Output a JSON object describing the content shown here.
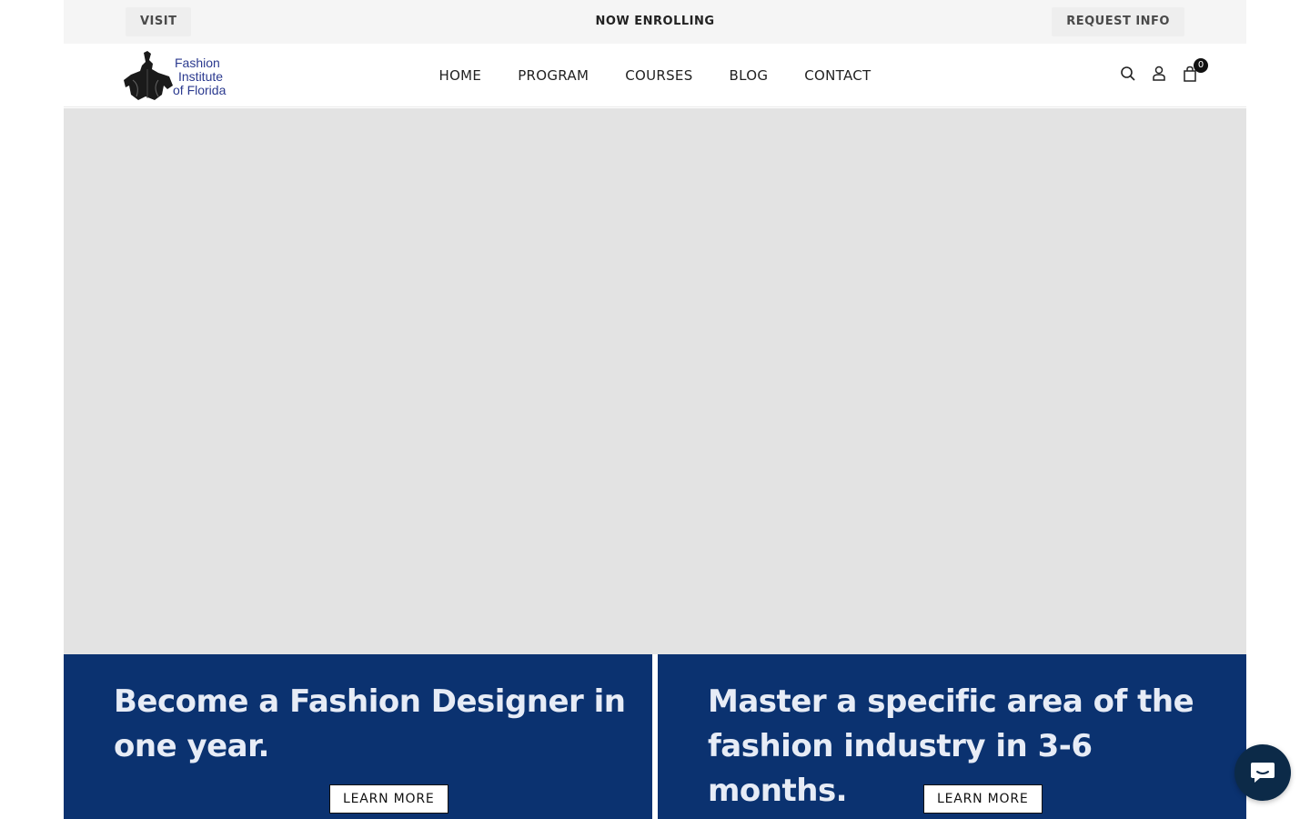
{
  "topbar": {
    "visit_label": "VISIT",
    "center_label": "NOW ENROLLING",
    "request_label": "REQUEST INFO"
  },
  "header": {
    "logo": {
      "line1": "Fashion",
      "line2": "Institute",
      "line3": "of Florida"
    },
    "nav": [
      {
        "label": "HOME"
      },
      {
        "label": "PROGRAM"
      },
      {
        "label": "COURSES"
      },
      {
        "label": "BLOG"
      },
      {
        "label": "CONTACT"
      }
    ],
    "icons": [
      "search-icon",
      "user-icon",
      "cart-icon"
    ],
    "cart_count": "0"
  },
  "promos": [
    {
      "heading": "Become a  Fashion Designer in one year.",
      "button": "LEARN MORE"
    },
    {
      "heading": "Master a specific area of the fashion industry in 3-6 months.",
      "button": "LEARN MORE"
    }
  ],
  "colors": {
    "promo_bg": "#0b3270",
    "hero_placeholder": "#e3e3e3",
    "logo_text": "#2b3a8f",
    "chat_bg": "#0c2a48"
  },
  "chat": {
    "icon": "chat-icon"
  }
}
